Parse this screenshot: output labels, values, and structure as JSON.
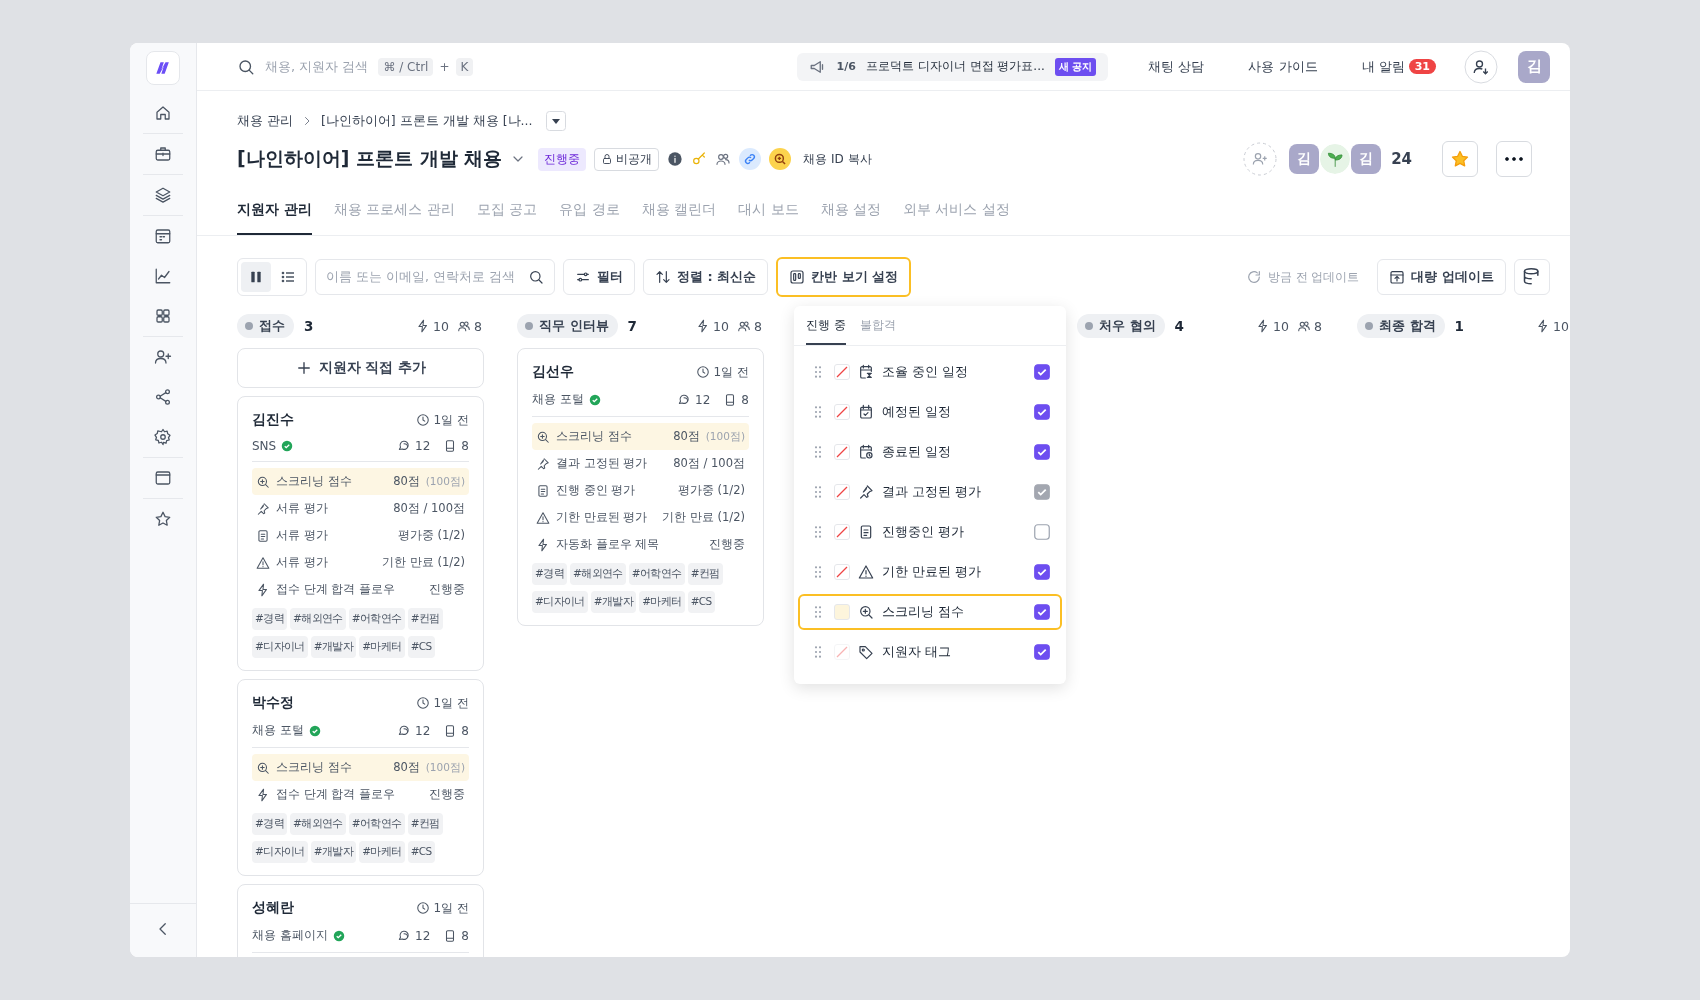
{
  "topbar": {
    "search_placeholder": "채용, 지원자 검색",
    "shortcut": [
      "⌘ / Ctrl",
      "+",
      "K"
    ],
    "notice": {
      "counter": "1/6",
      "text": "프로덕트 디자이너 면접 평가표...",
      "badge": "새 공지"
    },
    "links": [
      {
        "label": "채팅 상담"
      },
      {
        "label": "사용 가이드"
      },
      {
        "label": "내 알림",
        "badge": "31"
      }
    ],
    "avatar": "김"
  },
  "header": {
    "breadcrumb": [
      "채용 관리",
      "[나인하이어] 프론트 개발 채용 [나..."
    ],
    "title": "[나인하이어] 프론트 개발 채용",
    "status": "진행중",
    "visibility": "비공개",
    "copy_id": "채용 ID 복사",
    "members": [
      {
        "kind": "initial",
        "text": "김"
      },
      {
        "kind": "plant"
      },
      {
        "kind": "initial",
        "text": "김"
      }
    ],
    "member_count": "24",
    "starred": true
  },
  "tabs": [
    {
      "label": "지원자 관리",
      "selected": true
    },
    {
      "label": "채용 프로세스 관리",
      "selected": false
    },
    {
      "label": "모집 공고",
      "selected": false
    },
    {
      "label": "유입 경로",
      "selected": false
    },
    {
      "label": "채용 캘린더",
      "selected": false
    },
    {
      "label": "대시 보드",
      "selected": false
    },
    {
      "label": "채용 설정",
      "selected": false
    },
    {
      "label": "외부 서비스 설정",
      "selected": false
    }
  ],
  "toolbar": {
    "view_modes": [
      {
        "kind": "kanban",
        "selected": true
      },
      {
        "kind": "list",
        "selected": false
      }
    ],
    "search_placeholder": "이름 또는 이메일, 연락처로 검색",
    "filter": "필터",
    "sort": "정렬 : 최신순",
    "kanban_settings": {
      "label": "칸반 보기 설정",
      "active": true
    },
    "updated": "방금 전 업데이트",
    "bulk_update": "대량 업데이트"
  },
  "columns": [
    {
      "name": "접수",
      "count": "3",
      "flows": "10",
      "people": "8",
      "add_button": "지원자 직접 추가",
      "cards": [
        {
          "name": "김진수",
          "time": "1일 전",
          "source": "SNS",
          "verified": true,
          "comments": "12",
          "docs": "8",
          "rows": [
            {
              "kind": "screening",
              "label": "스크리닝 점수",
              "value": "80점",
              "note": "(100점)"
            },
            {
              "kind": "pinned",
              "label": "서류 평가",
              "value": "80점 / 100점"
            },
            {
              "kind": "progress",
              "label": "서류 평가",
              "value": "평가중 (1/2)"
            },
            {
              "kind": "expired",
              "label": "서류 평가",
              "value": "기한 만료 (1/2)"
            },
            {
              "kind": "flow",
              "label": "접수 단계 합격 플로우",
              "value": "진행중"
            }
          ],
          "tags": [
            "#경력",
            "#해외연수",
            "#어학연수",
            "#컨펌",
            "#디자이너",
            "#개발자",
            "#마케터",
            "#CS"
          ]
        },
        {
          "name": "박수정",
          "time": "1일 전",
          "source": "채용 포털",
          "verified": true,
          "comments": "12",
          "docs": "8",
          "rows": [
            {
              "kind": "screening",
              "label": "스크리닝 점수",
              "value": "80점",
              "note": "(100점)"
            },
            {
              "kind": "flow",
              "label": "접수 단계 합격 플로우",
              "value": "진행중"
            }
          ],
          "tags": [
            "#경력",
            "#해외연수",
            "#어학연수",
            "#컨펌",
            "#디자이너",
            "#개발자",
            "#마케터",
            "#CS"
          ]
        },
        {
          "name": "성혜란",
          "time": "1일 전",
          "source": "채용 홈페이지",
          "verified": true,
          "comments": "12",
          "docs": "8"
        }
      ]
    },
    {
      "name": "직무 인터뷰",
      "count": "7",
      "flows": "10",
      "people": "8",
      "cards": [
        {
          "name": "김선우",
          "time": "1일 전",
          "source": "채용 포털",
          "verified": true,
          "comments": "12",
          "docs": "8",
          "rows": [
            {
              "kind": "screening",
              "label": "스크리닝 점수",
              "value": "80점",
              "note": "(100점)"
            },
            {
              "kind": "pinned",
              "label": "결과 고정된 평가",
              "value": "80점 / 100점"
            },
            {
              "kind": "progress",
              "label": "진행 중인 평가",
              "value": "평가중 (1/2)"
            },
            {
              "kind": "expired",
              "label": "기한 만료된 평가",
              "value": "기한 만료 (1/2)"
            },
            {
              "kind": "flow",
              "label": "자동화 플로우 제목",
              "value": "진행중"
            }
          ],
          "tags": [
            "#경력",
            "#해외연수",
            "#어학연수",
            "#컨펌",
            "#디자이너",
            "#개발자",
            "#마케터",
            "#CS"
          ]
        }
      ]
    },
    {
      "name": "처우 협의",
      "count": "4",
      "flows": "10",
      "people": "8"
    },
    {
      "name": "최종 합격",
      "count": "1",
      "flows": "10"
    }
  ],
  "settings_panel": {
    "tabs": [
      {
        "label": "진행 중",
        "selected": true
      },
      {
        "label": "불합격",
        "selected": false
      }
    ],
    "items": [
      {
        "kind": "schedule-pending",
        "label": "조율 중인 일정",
        "checked": true,
        "disabled": false,
        "highlighted": false,
        "swatch_faded": false
      },
      {
        "kind": "schedule",
        "label": "예정된 일정",
        "checked": true,
        "disabled": false,
        "highlighted": false,
        "swatch_faded": false
      },
      {
        "kind": "schedule-done",
        "label": "종료된 일정",
        "checked": true,
        "disabled": false,
        "highlighted": false,
        "swatch_faded": false
      },
      {
        "kind": "pinned",
        "label": "결과 고정된 평가",
        "checked": true,
        "disabled": true,
        "highlighted": false,
        "swatch_faded": false
      },
      {
        "kind": "progress",
        "label": "진행중인 평가",
        "checked": false,
        "disabled": false,
        "highlighted": false,
        "swatch_faded": false
      },
      {
        "kind": "expired",
        "label": "기한 만료된 평가",
        "checked": true,
        "disabled": false,
        "highlighted": false,
        "swatch_faded": false
      },
      {
        "kind": "screening",
        "label": "스크리닝 점수",
        "checked": true,
        "disabled": false,
        "highlighted": true,
        "swatch_faded": false,
        "color": "#fdf5dc"
      },
      {
        "kind": "tag",
        "label": "지원자 태그",
        "checked": true,
        "disabled": false,
        "highlighted": false,
        "swatch_faded": true
      }
    ]
  }
}
